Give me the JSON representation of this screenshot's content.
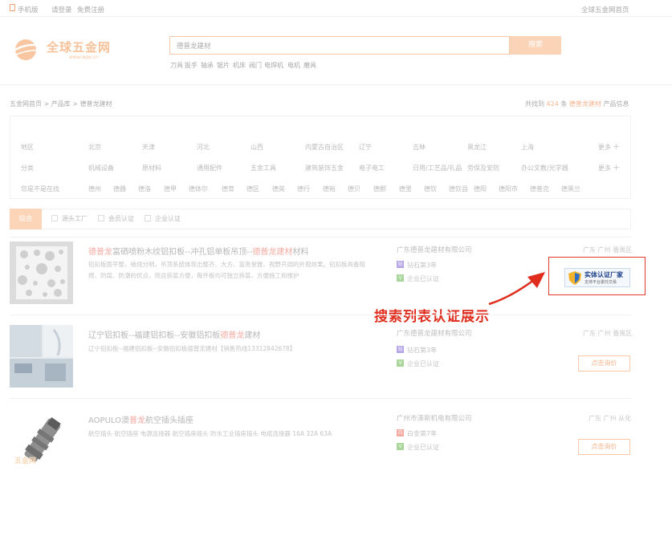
{
  "topbar": {
    "mobile": "手机版",
    "login": "请登录",
    "register": "免费注册",
    "home": "全球五金网首页"
  },
  "logo": {
    "name": "全球五金网",
    "url": "www.wjw.cn"
  },
  "search": {
    "value": "德普龙建材",
    "button": "搜索"
  },
  "hot_keywords": [
    "刀具",
    "扳手",
    "轴承",
    "锯片",
    "机床",
    "阀门",
    "电焊机",
    "电机",
    "磨具"
  ],
  "breadcrumb": "五金网首页 > 产品库 > 德普龙建材",
  "result": {
    "prefix": "共找到",
    "count": "424",
    "unit": "条",
    "keyword": "德普龙建材",
    "suffix": "产品信息"
  },
  "filters": {
    "region": {
      "label": "地区",
      "items": [
        "北京",
        "天津",
        "河北",
        "山西",
        "内蒙古自治区",
        "辽宁",
        "吉林",
        "黑龙江",
        "上海"
      ],
      "more": "更多"
    },
    "category": {
      "label": "分类",
      "items": [
        "机械设备",
        "原材料",
        "通用配件",
        "五金工具",
        "建筑装饰五金",
        "电子电工",
        "日用/工艺品/礼品",
        "劳保及安防",
        "办公文教/光学器"
      ],
      "more": "更多"
    },
    "related": {
      "label": "您是不是在找",
      "items": [
        "德州",
        "德器",
        "德洛",
        "德甲",
        "德体尔",
        "德育",
        "德区",
        "德英",
        "德行",
        "德裕",
        "德贝",
        "德郡",
        "德里",
        "德钦",
        "德钦县",
        "德阳",
        "德阳市",
        "德普克",
        "德黑兰"
      ]
    }
  },
  "sort": {
    "active": "综合",
    "options": [
      "源头工厂",
      "会员认证",
      "企业认证"
    ]
  },
  "products": [
    {
      "title_parts": [
        {
          "t": "德普龙",
          "hl": true
        },
        {
          "t": "富硒喷粉木纹铝扣板--冲孔铝单板吊顶--",
          "hl": false
        },
        {
          "t": "德普龙建材",
          "hl": true
        },
        {
          "t": "材料",
          "hl": false
        }
      ],
      "desc": "铝扣板面平整，棱线分明，吊顶系统体现出整齐、大方、富贵堂雅、视野开阔的外观效果。铝扣板具备阻燃、防腐、防潮的优点，而且拆装方便，每件板均可独立拆装，方便施工和维护",
      "company": "广东德普龙建材有限公司",
      "location": "广东 广州 番禺区",
      "level": "钻石第3年",
      "verified": "企业已认证"
    },
    {
      "title_parts": [
        {
          "t": "辽宁铝扣板--福建铝扣板--安徽铝扣板",
          "hl": false
        },
        {
          "t": "德普龙",
          "hl": true
        },
        {
          "t": "建材",
          "hl": false
        }
      ],
      "desc": "辽宁铝扣板--福建铝扣板--安徽铝扣板德普龙建材【销售热线13312842678】",
      "company": "广东德普龙建材有限公司",
      "location": "广东 广州 番禺区",
      "level": "钻石第3年",
      "verified": "企业已认证",
      "button": "点击询价"
    },
    {
      "title_parts": [
        {
          "t": "AOPULO澳",
          "hl": false
        },
        {
          "t": "普龙",
          "hl": true
        },
        {
          "t": "航空插头插座",
          "hl": false
        }
      ],
      "desc": "航空插头 航空插座 电源连接器 航空插座插头 防水工业插座插头 电缆连接器 16A 32A 63A",
      "company": "广州市泽新机电有限公司",
      "location": "广东 广州 从化",
      "level": "白金第7年",
      "verified": "企业已认证",
      "button": "点击询价",
      "watermark": "五金网"
    }
  ],
  "cert_badge": {
    "title": "实体认证厂家",
    "subtitle": "支持平台委托交易"
  },
  "annotation": "搜索列表认证展示",
  "colors": {
    "accent": "#f6b58f",
    "highlight": "#f4a9a1",
    "annotation": "#e02c1c"
  }
}
